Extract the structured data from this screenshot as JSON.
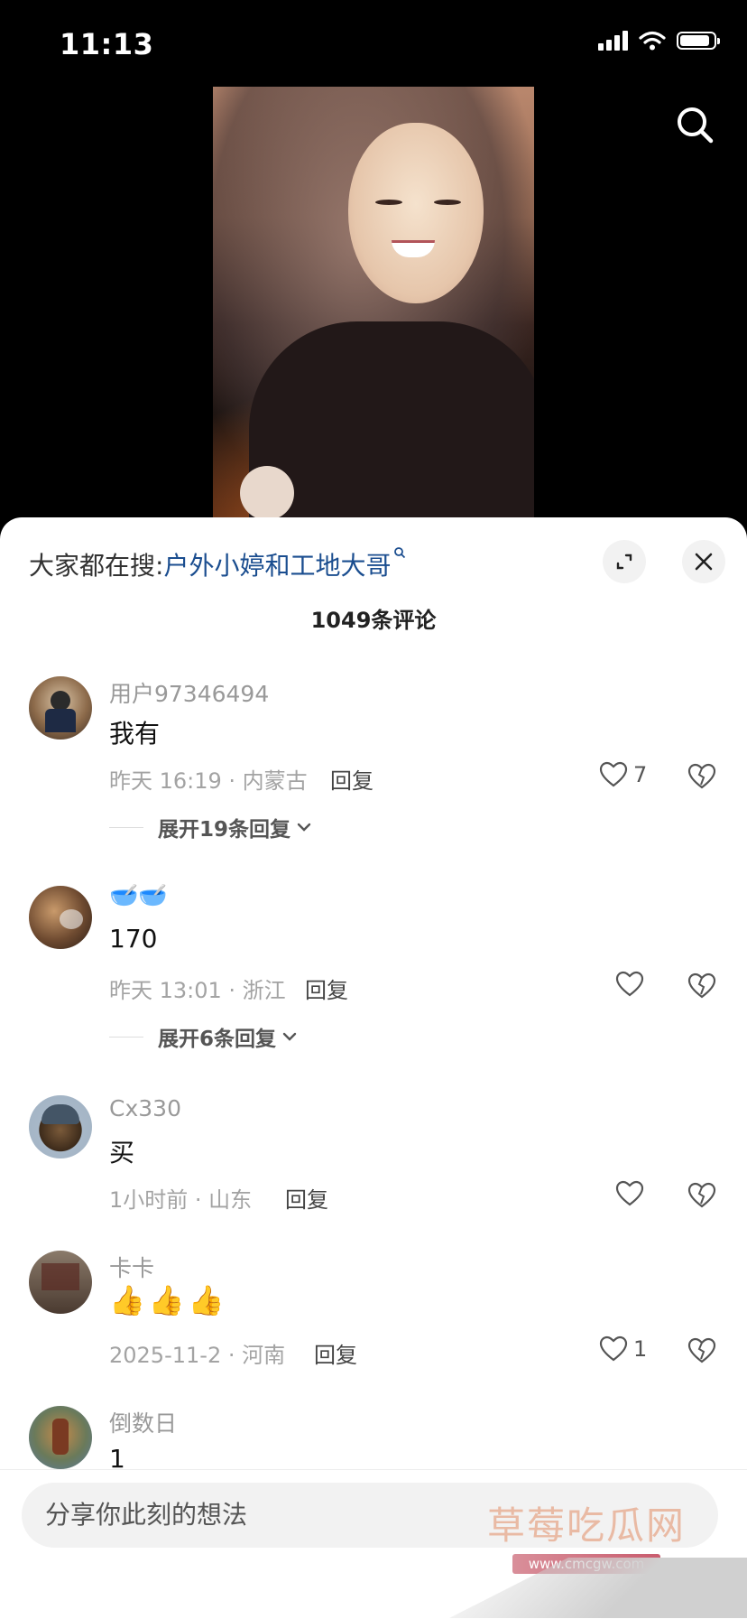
{
  "status_bar": {
    "time": "11:13"
  },
  "sheet": {
    "trending_prefix": "大家都在搜:",
    "trending_term": "户外小婷和工地大哥",
    "comment_count": "1049条评论"
  },
  "comments": [
    {
      "username": "用户97346494",
      "text": "我有",
      "meta": "昨天 16:19 · 内蒙古",
      "reply": "回复",
      "likes": "7",
      "expand": "展开19条回复"
    },
    {
      "username": "🥣🥣",
      "text": "170",
      "meta": "昨天 13:01 · 浙江",
      "reply": "回复",
      "likes": "",
      "expand": "展开6条回复"
    },
    {
      "username": "Cx330",
      "text": "买",
      "meta": "1小时前 · 山东",
      "reply": "回复",
      "likes": ""
    },
    {
      "username": "卡卡",
      "text": "👍👍👍",
      "meta": "2025-11-2 · 河南",
      "reply": "回复",
      "likes": "1"
    },
    {
      "username": "倒数日",
      "text": "1"
    }
  ],
  "input": {
    "placeholder": "分享你此刻的想法"
  },
  "watermark": {
    "title": "草莓吃瓜网",
    "url": "www.cmcgw.com"
  }
}
